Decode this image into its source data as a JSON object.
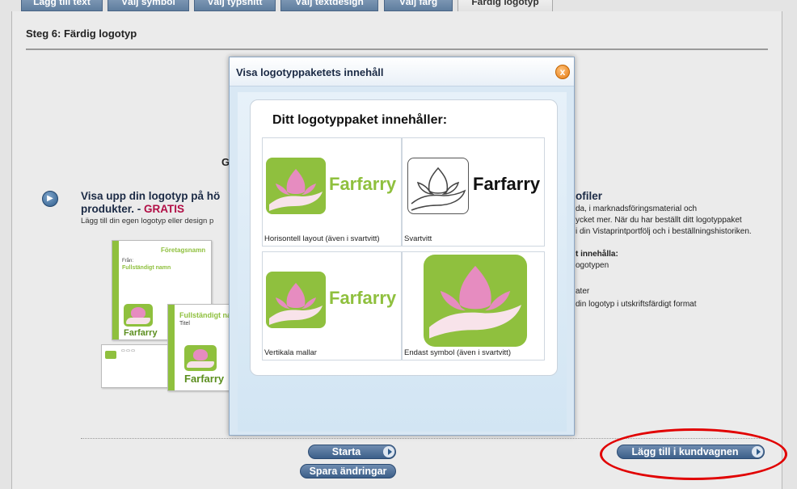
{
  "tabs": [
    {
      "label": "Lägg till text",
      "active": false
    },
    {
      "label": "Välj symbol",
      "active": false
    },
    {
      "label": "Välj typsnitt",
      "active": false
    },
    {
      "label": "Välj textdesign",
      "active": false
    },
    {
      "label": "Välj färg",
      "active": false
    },
    {
      "label": "Färdig logotyp",
      "active": true
    }
  ],
  "page": {
    "step_title": "Steg 6: Färdig logotyp",
    "bg_letter": "G",
    "show": {
      "heading_line1": "Visa upp din logotyp på hö",
      "heading_line2_prefix": "produkter. - ",
      "gratis": "GRATIS",
      "sub": "Lägg till din egen logotyp eller design p"
    },
    "cards": {
      "company": "Företagsnamn",
      "from": "Från:",
      "fullname": "Fullständigt namn",
      "fullname_short": "Fullständigt namn",
      "title": "Titel",
      "brand": "Farfarry"
    },
    "right": {
      "heading": "ofiler",
      "line1": "da, i marknadsföringsmaterial och",
      "line2": "ycket mer. När du har beställt ditt logotyppaket",
      "line3": "i din Vistaprintportfölj och i beställningshistoriken.",
      "contents_head": "t innehålla:",
      "item1": "ogotypen",
      "item2": "ater",
      "item3": "din logotyp i utskriftsfärdigt format"
    }
  },
  "buttons": {
    "start": "Starta",
    "save": "Spara ändringar",
    "add_to_cart": "Lägg till i kundvagnen"
  },
  "modal": {
    "title": "Visa logotyppaketets innehåll",
    "close": "x",
    "panel_title": "Ditt logotyppaket innehåller:",
    "cells": [
      {
        "label": "Horisontell layout (även i svartvitt)"
      },
      {
        "label": "Svartvitt"
      },
      {
        "label": "Vertikala mallar"
      },
      {
        "label": "Endast symbol (även i svartvitt)"
      }
    ],
    "brand": "Farfarry"
  },
  "colors": {
    "brand_green": "#8fc03e",
    "brand_pink": "#e68cc0",
    "brand_word": "#5b8e1e",
    "highlight_red": "#e10000"
  }
}
